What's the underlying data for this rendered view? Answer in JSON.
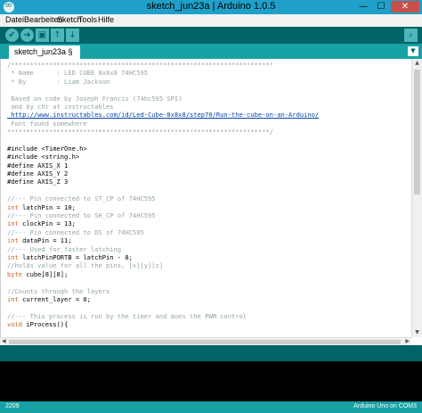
{
  "window": {
    "title": "sketch_jun23a | Arduino 1.0.5",
    "min_glyph": "—",
    "max_glyph": "☐",
    "close_glyph": "✕"
  },
  "menu": [
    "Datei",
    "Bearbeiten",
    "Sketch",
    "Tools",
    "Hilfe"
  ],
  "toolbar": {
    "verify_icon": "check-icon",
    "upload_icon": "arrow-right-icon",
    "new_icon": "new-file-icon",
    "open_icon": "arrow-up-icon",
    "save_icon": "arrow-down-icon",
    "serial_monitor_icon": "magnifier-icon",
    "glyphs": {
      "verify": "✔",
      "upload": "➜",
      "new": "▣",
      "open": "↑",
      "save": "↓",
      "serial": "⌕"
    }
  },
  "tab": {
    "label": "sketch_jun23a §",
    "menu_glyph": "▼"
  },
  "code_lines": [
    {
      "t": "/*********************************************************************",
      "c": "comment"
    },
    {
      "t": " * Name      : LED CUBE 8x8x8 74HC595",
      "c": "comment"
    },
    {
      "t": " * By        : Liam Jackson",
      "c": "comment"
    },
    {
      "t": "",
      "c": "comment"
    },
    {
      "t": " Based on code by Joseph Francis (74hc595 SPI)",
      "c": "comment"
    },
    {
      "t": " and by chr at instructables",
      "c": "comment"
    },
    {
      "t": " http://www.instructables.com/id/Led-Cube-8x8x8/step70/Run-the-cube-on-an-Arduino/",
      "c": "link"
    },
    {
      "t": " Font found somewhere",
      "c": "comment"
    },
    {
      "t": "*********************************************************************/",
      "c": "comment"
    },
    {
      "t": "",
      "c": "plain"
    },
    {
      "t": "#include <TimerOne.h>",
      "c": "plain"
    },
    {
      "t": "#include <string.h>",
      "c": "plain"
    },
    {
      "t": "#define AXIS_X 1",
      "c": "plain"
    },
    {
      "t": "#define AXIS_Y 2",
      "c": "plain"
    },
    {
      "t": "#define AXIS_Z 3",
      "c": "plain"
    },
    {
      "t": "",
      "c": "plain"
    },
    {
      "t": "//--- Pin connected to ST_CP of 74HC595",
      "c": "comment"
    },
    {
      "t": "int latchPin = 10;",
      "c": "type"
    },
    {
      "t": "//--- Pin connected to SH_CP of 74HC595",
      "c": "comment"
    },
    {
      "t": "int clockPin = 13;",
      "c": "type"
    },
    {
      "t": "//--- Pin connected to DS of 74HC595",
      "c": "comment"
    },
    {
      "t": "int dataPin = 11;",
      "c": "type"
    },
    {
      "t": "//--- Used for faster latching",
      "c": "comment"
    },
    {
      "t": "int latchPinPORTB = latchPin - 8;",
      "c": "type"
    },
    {
      "t": "//holds value for all the pins, [x][y][z]",
      "c": "comment"
    },
    {
      "t": "byte cube[8][8];",
      "c": "type"
    },
    {
      "t": "",
      "c": "plain"
    },
    {
      "t": "//Counts through the layers",
      "c": "comment"
    },
    {
      "t": "int current_layer = 0;",
      "c": "type"
    },
    {
      "t": "",
      "c": "plain"
    },
    {
      "t": "//--- This process is run by the timer and does the PWM control",
      "c": "comment"
    },
    {
      "t": "void iProcess(){",
      "c": "type"
    }
  ],
  "status": {
    "line_number": "2209",
    "board": "Arduino Uno on COM3"
  }
}
